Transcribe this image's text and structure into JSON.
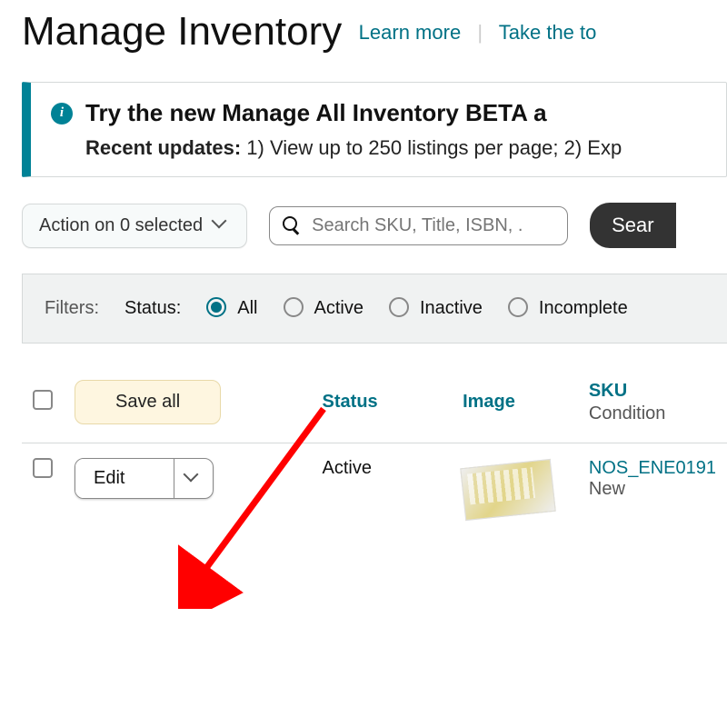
{
  "header": {
    "title": "Manage Inventory",
    "learn_more": "Learn more",
    "take_tour": "Take the to"
  },
  "beta": {
    "headline": "Try the new Manage All Inventory BETA a",
    "recent_label": "Recent updates:",
    "recent_body": " 1) View up to 250 listings per page; 2) Exp"
  },
  "toolbar": {
    "action_label": "Action on 0 selected",
    "search_placeholder": "Search SKU, Title, ISBN, .",
    "search_button": "Sear"
  },
  "filters": {
    "label": "Filters:",
    "status_label": "Status:",
    "options": [
      "All",
      "Active",
      "Inactive",
      "Incomplete"
    ],
    "selected": "All"
  },
  "table": {
    "save_all": "Save all",
    "cols": {
      "status": "Status",
      "image": "Image",
      "sku": "SKU",
      "sku_sub": "Condition"
    },
    "rows": [
      {
        "edit_label": "Edit",
        "status": "Active",
        "sku": "NOS_ENE0191",
        "condition": "New"
      }
    ]
  }
}
